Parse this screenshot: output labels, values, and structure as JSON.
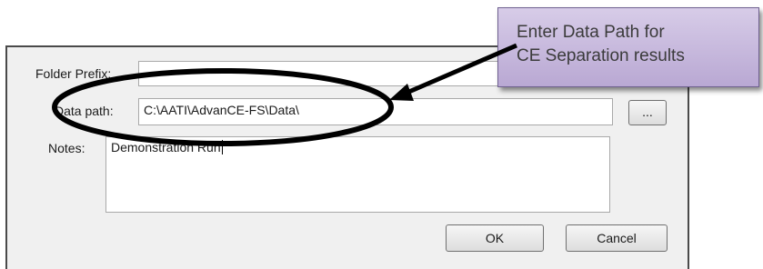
{
  "dialog": {
    "folder_prefix_label": "Folder Prefix:",
    "folder_prefix_value": "",
    "data_path_label": "Data path:",
    "data_path_value": "C:\\AATI\\AdvanCE-FS\\Data\\",
    "browse_label": "...",
    "notes_label": "Notes:",
    "notes_value": "Demonstration Run",
    "ok_label": "OK",
    "cancel_label": "Cancel"
  },
  "callout": {
    "line1": "Enter Data Path for",
    "line2": "CE Separation results",
    "color": "#c8bbe0",
    "annotation_color": "#000000"
  }
}
